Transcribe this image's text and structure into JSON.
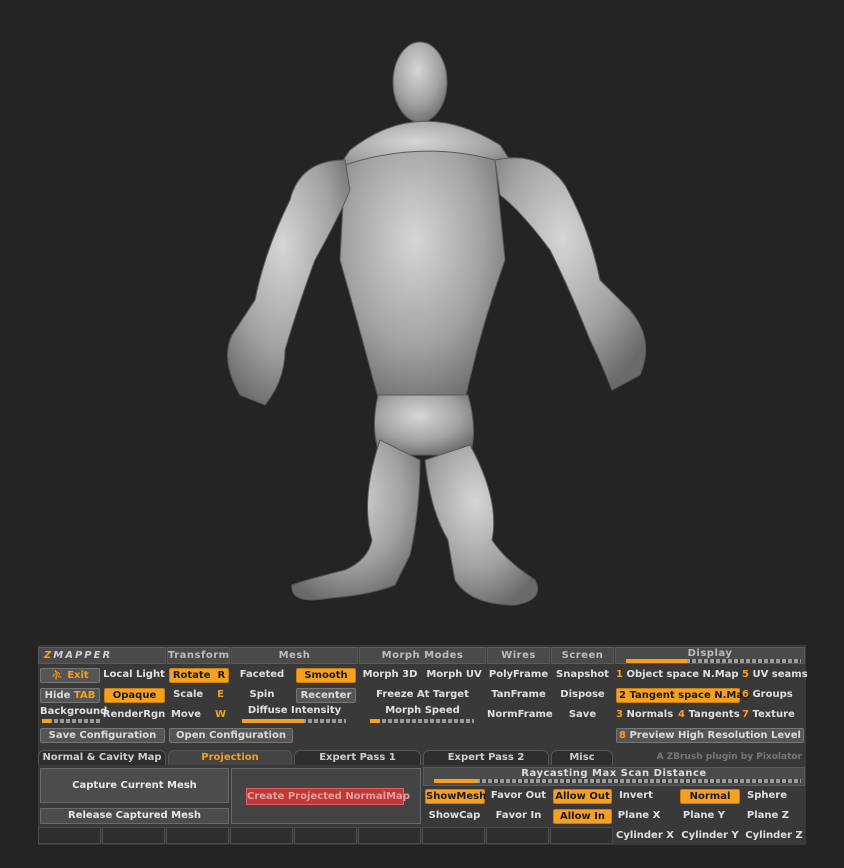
{
  "panel": {
    "logo_z": "Z",
    "logo_rest": "MAPPER",
    "headers": [
      "Transform",
      "Mesh",
      "Morph Modes",
      "Wires",
      "Screen",
      "Display"
    ],
    "left": {
      "exit": "Exit",
      "local_light": "Local Light",
      "hide_tab": "Hide",
      "hide_tab_key": "TAB",
      "opaque": "Opaque",
      "background": "Background",
      "render_rgn": "RenderRgn"
    },
    "transform": {
      "rotate": "Rotate",
      "rotate_key": "R",
      "scale": "Scale",
      "scale_key": "E",
      "move": "Move",
      "move_key": "W"
    },
    "mesh": {
      "faceted": "Faceted",
      "smooth": "Smooth",
      "spin": "Spin",
      "recenter": "Recenter",
      "diffuse_intensity": "Diffuse Intensity"
    },
    "morph": {
      "morph_3d": "Morph 3D",
      "morph_uv": "Morph UV",
      "freeze_at_target": "Freeze At Target",
      "morph_speed": "Morph Speed"
    },
    "wires": {
      "polyframe": "PolyFrame",
      "tanframe": "TanFrame",
      "normframe": "NormFrame"
    },
    "screen": {
      "snapshot": "Snapshot",
      "dispose": "Dispose",
      "save": "Save"
    },
    "display": {
      "items": [
        {
          "num": "1",
          "label": "Object space N.Map"
        },
        {
          "num": "5",
          "label": "UV seams"
        },
        {
          "num": "2",
          "label": "Tangent space N.Map"
        },
        {
          "num": "6",
          "label": "Groups"
        },
        {
          "num": "3",
          "label": "Normals"
        },
        {
          "num": "4",
          "label": "Tangents"
        },
        {
          "num": "7",
          "label": "Texture"
        },
        {
          "num": "8",
          "label": "Preview High Resolution Level"
        }
      ]
    },
    "config": {
      "save": "Save Configuration",
      "open": "Open Configuration"
    },
    "tabs": [
      "Normal & Cavity Map",
      "Projection",
      "Expert Pass 1",
      "Expert Pass 2",
      "Misc"
    ],
    "credit": "A ZBrush plugin by Pixolator",
    "projection": {
      "capture": "Capture Current Mesh",
      "release": "Release Captured Mesh",
      "create": "Create Projected NormalMap",
      "raycast": "Raycasting Max Scan Distance",
      "show_mesh": "ShowMesh",
      "show_cap": "ShowCap",
      "favor_out": "Favor Out",
      "favor_in": "Favor In",
      "allow_out": "Allow Out",
      "allow_in": "Allow In",
      "invert": "Invert",
      "normal": "Normal",
      "sphere": "Sphere",
      "plane_x": "Plane X",
      "plane_y": "Plane Y",
      "plane_z": "Plane Z",
      "cylinder_x": "Cylinder X",
      "cylinder_y": "Cylinder Y",
      "cylinder_z": "Cylinder Z"
    },
    "sliders": {
      "background": 0.15,
      "diffuse_intensity": 0.6,
      "morph_speed": 0.1,
      "display": 0.35,
      "raycast": 0.12
    },
    "colors": {
      "accent": "#f5a021",
      "panel_bg": "#393939",
      "viewport_bg": "#242424",
      "create_button": "#c03838"
    }
  }
}
